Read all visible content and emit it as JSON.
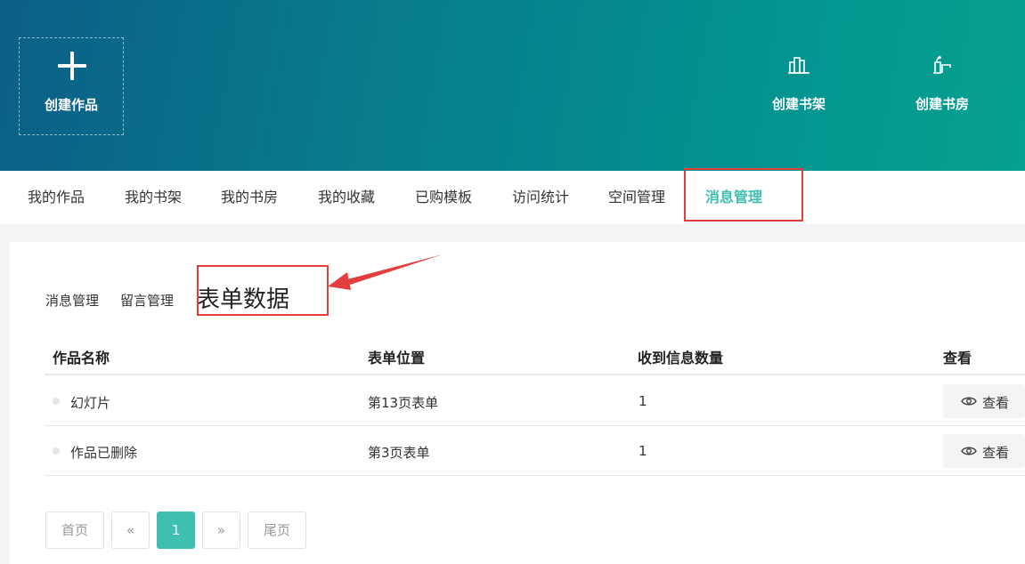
{
  "banner": {
    "create_work": {
      "label": "创建作品",
      "icon": "plus-icon"
    },
    "create_shelf": {
      "label": "创建书架",
      "icon": "bookshelf-icon"
    },
    "create_study": {
      "label": "创建书房",
      "icon": "study-room-icon"
    }
  },
  "tabs": [
    {
      "label": "我的作品"
    },
    {
      "label": "我的书架"
    },
    {
      "label": "我的书房"
    },
    {
      "label": "我的收藏"
    },
    {
      "label": "已购模板"
    },
    {
      "label": "访问统计"
    },
    {
      "label": "空间管理"
    },
    {
      "label": "消息管理",
      "active": true
    }
  ],
  "subtabs": [
    {
      "label": "消息管理"
    },
    {
      "label": "留言管理"
    },
    {
      "label": "表单数据",
      "active": true
    }
  ],
  "table": {
    "headers": [
      "作品名称",
      "表单位置",
      "收到信息数量",
      "查看"
    ],
    "rows": [
      {
        "name": "幻灯片",
        "position": "第13页表单",
        "count": "1",
        "action": "查看"
      },
      {
        "name": "作品已删除",
        "position": "第3页表单",
        "count": "1",
        "action": "查看"
      }
    ]
  },
  "pagination": {
    "first": "首页",
    "prev": "«",
    "current": "1",
    "next": "»",
    "last": "尾页"
  },
  "colors": {
    "accent": "#3fbfb0",
    "annotation": "#e43d3d",
    "banner_start": "#0b5f86",
    "banner_end": "#06a191"
  }
}
